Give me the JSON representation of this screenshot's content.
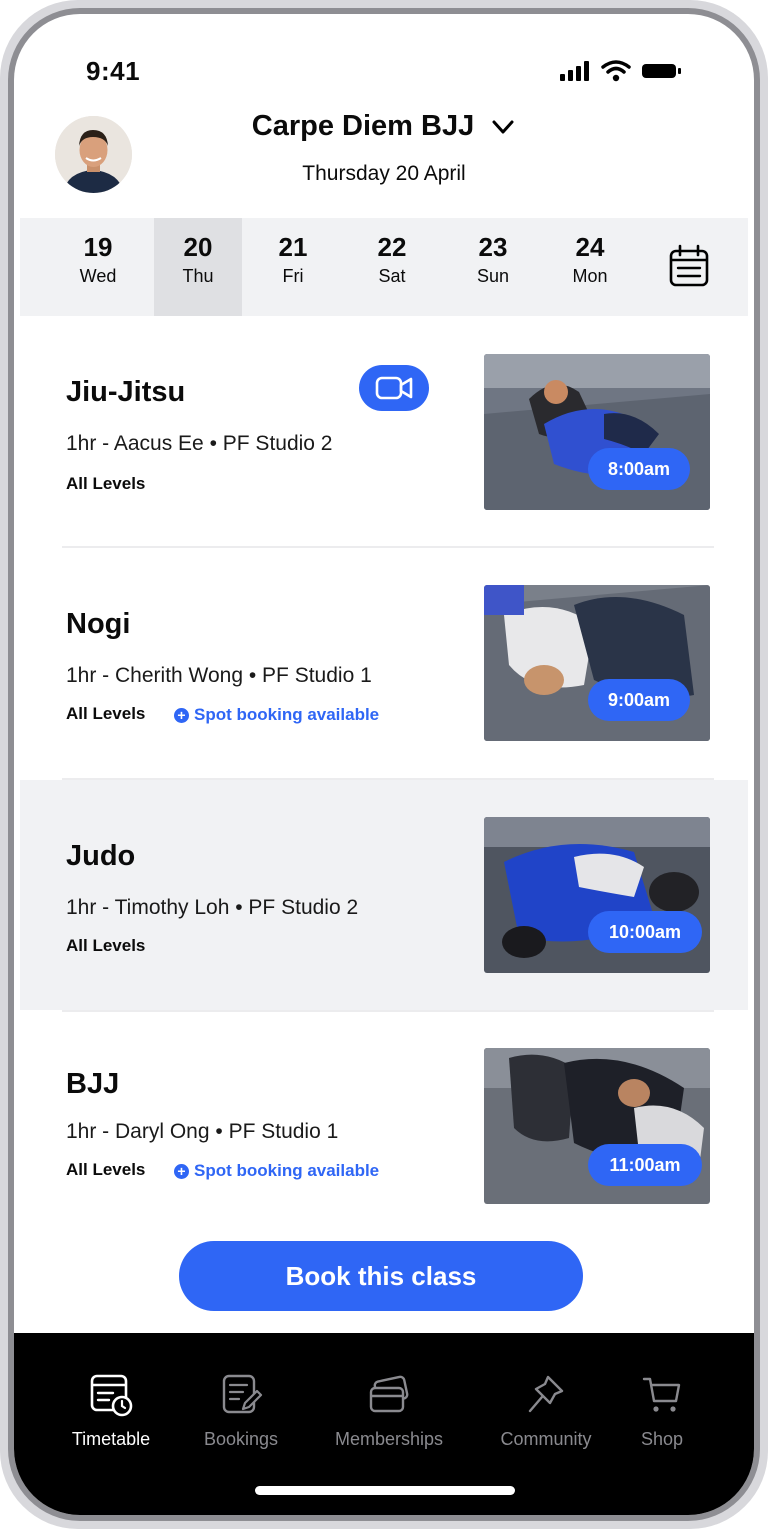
{
  "status_bar": {
    "time": "9:41"
  },
  "header": {
    "gym_name": "Carpe Diem BJJ",
    "date": "Thursday 20 April"
  },
  "date_strip": {
    "days": [
      {
        "num": "19",
        "dow": "Wed",
        "active": false
      },
      {
        "num": "20",
        "dow": "Thu",
        "active": true
      },
      {
        "num": "21",
        "dow": "Fri",
        "active": false
      },
      {
        "num": "22",
        "dow": "Sat",
        "active": false
      },
      {
        "num": "23",
        "dow": "Sun",
        "active": false
      },
      {
        "num": "24",
        "dow": "Mon",
        "active": false
      }
    ]
  },
  "classes": [
    {
      "name": "Jiu-Jitsu",
      "meta": "1hr - Aacus Ee • PF Studio 2",
      "level": "All Levels",
      "time": "8:00am",
      "video": true
    },
    {
      "name": "Nogi",
      "meta": "1hr - Cherith Wong • PF Studio 1",
      "level": "All Levels",
      "spot": "Spot booking available",
      "time": "9:00am"
    },
    {
      "name": "Judo",
      "meta": "1hr - Timothy Loh • PF Studio 2",
      "level": "All Levels",
      "time": "10:00am",
      "selected": true
    },
    {
      "name": "BJJ",
      "meta": "1hr - Daryl Ong • PF Studio 1",
      "level": "All Levels",
      "spot": "Spot booking available",
      "time": "11:00am"
    }
  ],
  "book_button": {
    "label": "Book this class"
  },
  "bottom_nav": {
    "items": [
      {
        "label": "Timetable",
        "icon": "timetable-icon",
        "active": true
      },
      {
        "label": "Bookings",
        "icon": "bookings-icon"
      },
      {
        "label": "Memberships",
        "icon": "memberships-icon"
      },
      {
        "label": "Community",
        "icon": "community-icon"
      },
      {
        "label": "Shop",
        "icon": "shop-icon"
      }
    ]
  },
  "colors": {
    "accent": "#2f66f5",
    "strip": "#f1f2f4",
    "nav_bg": "#000000"
  }
}
